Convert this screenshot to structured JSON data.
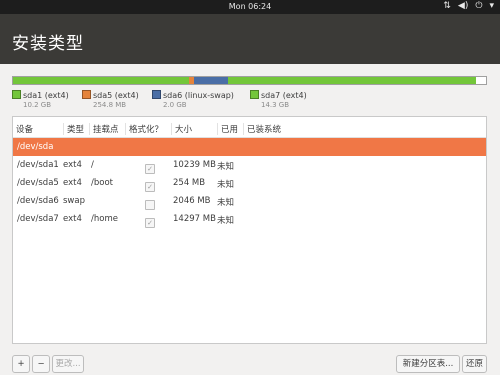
{
  "topbar": {
    "clock": "Mon 06:24",
    "icons": [
      "network-icon",
      "volume-icon",
      "power-icon",
      "chevron-down-icon"
    ]
  },
  "header": {
    "title": "安装类型"
  },
  "disk_bar": {
    "segments": [
      {
        "name": "sda1",
        "fraction": 0.373,
        "color": "#73c63a"
      },
      {
        "name": "sda5",
        "fraction": 0.009,
        "color": "#e5843c"
      },
      {
        "name": "sda6",
        "fraction": 0.073,
        "color": "#4a6ea6"
      },
      {
        "name": "sda7",
        "fraction": 0.524,
        "color": "#73c63a"
      },
      {
        "name": "free",
        "fraction": 0.021,
        "color": "#ffffff"
      }
    ]
  },
  "legend": [
    {
      "name": "sda1 (ext4)",
      "size": "10.2 GB",
      "color": "#73c63a"
    },
    {
      "name": "sda5 (ext4)",
      "size": "254.8 MB",
      "color": "#e5843c"
    },
    {
      "name": "sda6 (linux-swap)",
      "size": "2.0 GB",
      "color": "#4a6ea6"
    },
    {
      "name": "sda7 (ext4)",
      "size": "14.3 GB",
      "color": "#73c63a"
    }
  ],
  "table": {
    "headers": [
      "设备",
      "类型",
      "挂载点",
      "格式化？",
      "大小",
      "已用",
      "已装系统"
    ],
    "device_row": "/dev/sda",
    "rows": [
      {
        "device": "/dev/sda1",
        "type": "ext4",
        "mount": "/",
        "format": true,
        "size": "10239 MB",
        "used": "未知",
        "system": ""
      },
      {
        "device": "/dev/sda5",
        "type": "ext4",
        "mount": "/boot",
        "format": true,
        "size": "254 MB",
        "used": "未知",
        "system": ""
      },
      {
        "device": "/dev/sda6",
        "type": "swap",
        "mount": "",
        "format": false,
        "size": "2046 MB",
        "used": "未知",
        "system": ""
      },
      {
        "device": "/dev/sda7",
        "type": "ext4",
        "mount": "/home",
        "format": true,
        "size": "14297 MB",
        "used": "未知",
        "system": ""
      }
    ]
  },
  "buttons": {
    "add": "+",
    "remove": "−",
    "change": "更改...",
    "new_table": "新建分区表...",
    "revert": "还原"
  },
  "colors": {
    "selected_row": "#f07746",
    "header_bg": "#3b3a37"
  }
}
